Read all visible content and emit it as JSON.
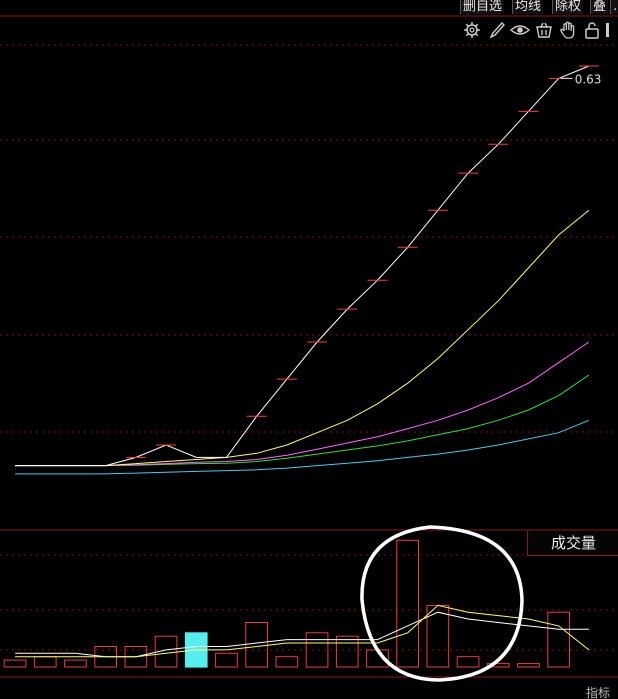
{
  "toolbar": {
    "buttons": [
      "删自选",
      "均线",
      "除权",
      "叠",
      "…"
    ],
    "icons": [
      "settings-gear-icon",
      "brush-icon",
      "eye-icon",
      "basket-icon",
      "hand-icon",
      "lock-icon",
      "more-icon"
    ]
  },
  "price_label": "0.63",
  "volume_label": "成交量",
  "bottom_tab": "指标",
  "chart_data": [
    {
      "type": "line",
      "title": "",
      "x": [
        0,
        1,
        2,
        3,
        4,
        5,
        6,
        7,
        8,
        9,
        10,
        11,
        12,
        13,
        14,
        15,
        16,
        17,
        18,
        19
      ],
      "price_ylim": [
        0,
        1
      ],
      "series": [
        {
          "name": "",
          "color": "#ffffff",
          "values": [
            0.03,
            0.03,
            0.03,
            0.03,
            0.05,
            0.08,
            0.05,
            0.05,
            0.15,
            0.24,
            0.33,
            0.41,
            0.48,
            0.56,
            0.65,
            0.74,
            0.81,
            0.89,
            0.97,
            1.0
          ]
        },
        {
          "name": "",
          "color": "#ffff66",
          "values": [
            0.03,
            0.03,
            0.03,
            0.03,
            0.035,
            0.04,
            0.045,
            0.05,
            0.06,
            0.08,
            0.11,
            0.14,
            0.18,
            0.23,
            0.29,
            0.36,
            0.43,
            0.51,
            0.59,
            0.65
          ]
        },
        {
          "name": "",
          "color": "#ff66ff",
          "values": [
            0.03,
            0.03,
            0.03,
            0.03,
            0.032,
            0.035,
            0.038,
            0.04,
            0.045,
            0.055,
            0.07,
            0.085,
            0.1,
            0.12,
            0.14,
            0.165,
            0.195,
            0.23,
            0.28,
            0.33
          ]
        },
        {
          "name": "",
          "color": "#33dd33",
          "values": [
            0.03,
            0.03,
            0.03,
            0.03,
            0.031,
            0.033,
            0.035,
            0.036,
            0.04,
            0.048,
            0.058,
            0.068,
            0.078,
            0.09,
            0.105,
            0.12,
            0.14,
            0.165,
            0.2,
            0.25
          ]
        },
        {
          "name": "",
          "color": "#44ccee",
          "values": [
            0.01,
            0.01,
            0.01,
            0.01,
            0.012,
            0.014,
            0.016,
            0.018,
            0.02,
            0.024,
            0.03,
            0.036,
            0.042,
            0.05,
            0.058,
            0.068,
            0.08,
            0.095,
            0.11,
            0.14
          ]
        }
      ]
    },
    {
      "type": "bar",
      "title": "成交量",
      "categories": [
        0,
        1,
        2,
        3,
        4,
        5,
        6,
        7,
        8,
        9,
        10,
        11,
        12,
        13,
        14,
        15,
        16,
        17,
        18,
        19
      ],
      "values": [
        2,
        3,
        2,
        6,
        6,
        9,
        10,
        4,
        13,
        3,
        10,
        9,
        5,
        37,
        18,
        3,
        1,
        1,
        16,
        0
      ],
      "colors": [
        "#e84040",
        "#e84040",
        "#e84040",
        "#e84040",
        "#e84040",
        "#e84040",
        "#55eeee",
        "#e84040",
        "#e84040",
        "#e84040",
        "#e84040",
        "#e84040",
        "#e84040",
        "#e84040",
        "#e84040",
        "#e84040",
        "#e84040",
        "#e84040",
        "#e84040",
        "#e84040"
      ],
      "ylim": [
        0,
        40
      ],
      "series": [
        {
          "name": "",
          "color": "#ffffff",
          "values": [
            4,
            4,
            4,
            3,
            3,
            5,
            6,
            6,
            7,
            8,
            8,
            8,
            8,
            12,
            16,
            14,
            13,
            12,
            11,
            11
          ]
        },
        {
          "name": "",
          "color": "#ffff66",
          "values": [
            3,
            3,
            3,
            3,
            3,
            4,
            5,
            5,
            6,
            7,
            7,
            7,
            7,
            10,
            18,
            16,
            15,
            14,
            12,
            5
          ]
        }
      ]
    }
  ]
}
